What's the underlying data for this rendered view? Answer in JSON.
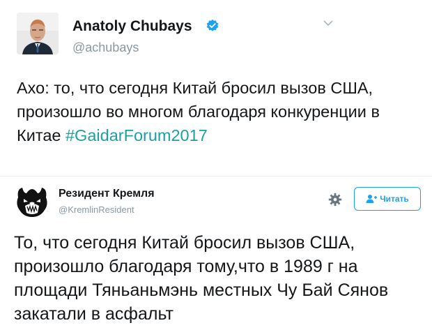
{
  "tweet1": {
    "author_name": "Anatoly Chubays",
    "handle": "@achubays",
    "text_main": "Ахо: то, что сегодня Китай бросил вызов США, произошло во многом благодаря конкуренции в Китае ",
    "hashtag": "#GaidarForum2017"
  },
  "tweet2": {
    "author_name": "Резидент Кремля",
    "handle": "@KremlinResident",
    "follow_label": "Читать",
    "text": "То, что сегодня Китай бросил вызов США, произошло благодаря тому,что в 1989 г на площади Тяньаньмэнь местных Чу Бай Сянов закатали в асфальт"
  },
  "colors": {
    "accent": "#1da1f2",
    "hashtag": "#1da1a0",
    "secondary_text": "#8899a6"
  },
  "icons": [
    "avatar-photo",
    "verified-icon",
    "chevron-down-icon",
    "bear-logo-avatar",
    "gear-icon",
    "follow-user-icon"
  ]
}
